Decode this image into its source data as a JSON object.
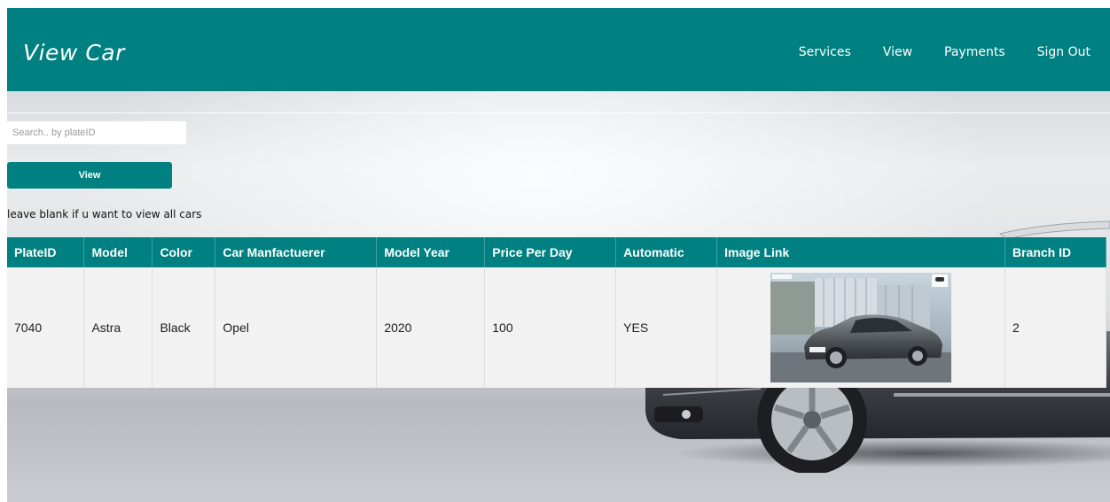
{
  "header": {
    "title": "View Car",
    "nav": [
      "Services",
      "View",
      "Payments",
      "Sign Out"
    ]
  },
  "search": {
    "placeholder": "Search.. by plateID",
    "value": ""
  },
  "view_button": "View",
  "hint": "leave blank if u want to view all cars",
  "table": {
    "columns": [
      "PlateID",
      "Model",
      "Color",
      "Car Manfactuerer",
      "Model Year",
      "Price Per Day",
      "Automatic",
      "Image Link",
      "Branch ID"
    ],
    "rows": [
      {
        "plate_id": "7040",
        "model": "Astra",
        "color": "Black",
        "manufacturer": "Opel",
        "model_year": "2020",
        "price_per_day": "100",
        "automatic": "YES",
        "image_alt": "car-photo",
        "branch_id": "2"
      }
    ]
  },
  "colors": {
    "primary": "#008080",
    "row_bg": "#f2f2f2"
  }
}
